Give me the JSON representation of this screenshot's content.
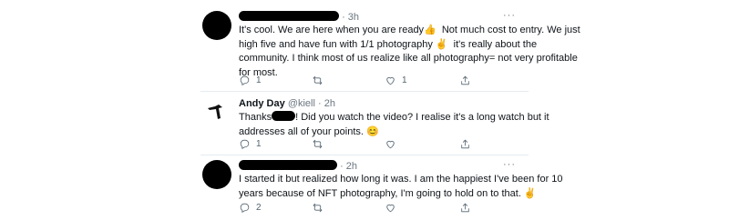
{
  "tweets": [
    {
      "name": "",
      "handle": "",
      "time": "3h",
      "body_lines": [
        "It's cool. We are here when you are ready👍  Not much cost to entry. We just",
        "high five and have fun with 1/1 photography ✌️  it's really about the",
        "community. I think most of us realize like all photography= not very profitable",
        "for most."
      ],
      "reply_count": "1",
      "retweet_count": "",
      "like_count": "1"
    },
    {
      "name": "Andy Day",
      "handle": "@kiell",
      "time": "2h",
      "body_prefix": "Thanks",
      "body_suffix": "! Did you watch the video? I realise it's a long watch but it",
      "body_line2": "addresses all of your points. 😊",
      "reply_count": "1",
      "retweet_count": "",
      "like_count": ""
    },
    {
      "name": "",
      "handle": "",
      "time": "2h",
      "body_lines": [
        "I started it but realized how long it was. I am the happiest I've been for 10",
        "years because of NFT photography, I'm going to hold on to that. ✌️"
      ],
      "reply_count": "2",
      "retweet_count": "",
      "like_count": ""
    }
  ],
  "icons": [
    "reply-icon",
    "retweet-icon",
    "like-icon",
    "share-icon",
    "more-icon"
  ],
  "colors": {
    "text": "#0f1419",
    "muted": "#6b7680",
    "icon": "#536471",
    "divider": "#e6ecf0"
  }
}
